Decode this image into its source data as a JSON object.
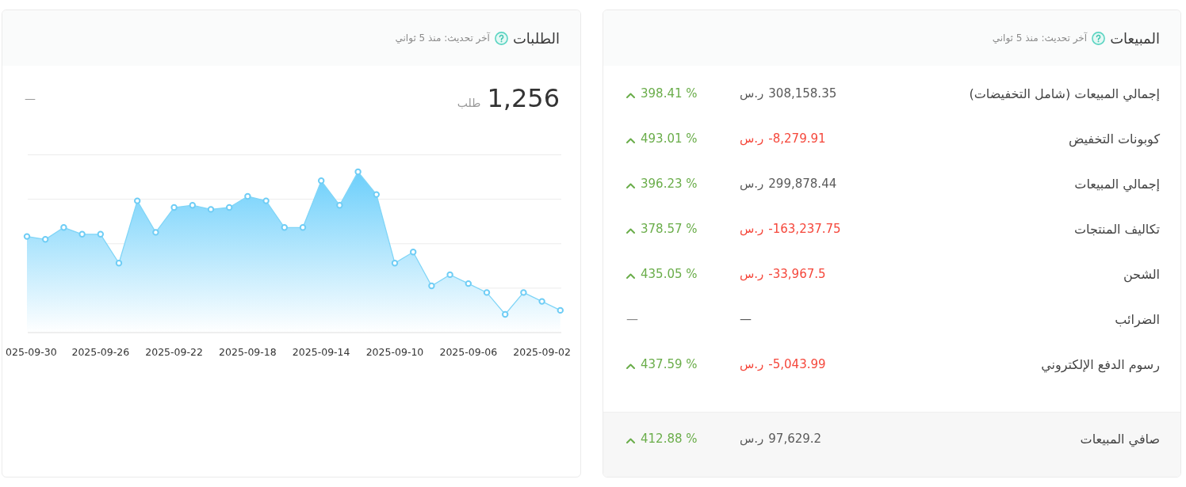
{
  "sales_card": {
    "title": "المبيعات",
    "last_update": "آخر تحديث: منذ 5 ثواني",
    "rows": [
      {
        "label": "إجمالي المبيعات (شامل التخفيضات)",
        "amount": "308,158.35",
        "currency": "ر.س",
        "negative": false,
        "change": "398.41 %",
        "rising": true
      },
      {
        "label": "كوبونات التخفيض",
        "amount": "-8,279.91",
        "currency": "ر.س",
        "negative": true,
        "change": "493.01 %",
        "rising": true
      },
      {
        "label": "إجمالي المبيعات",
        "amount": "299,878.44",
        "currency": "ر.س",
        "negative": false,
        "change": "396.23 %",
        "rising": true
      },
      {
        "label": "تكاليف المنتجات",
        "amount": "-163,237.75",
        "currency": "ر.س",
        "negative": true,
        "change": "378.57 %",
        "rising": true
      },
      {
        "label": "الشحن",
        "amount": "-33,967.5",
        "currency": "ر.س",
        "negative": true,
        "change": "435.05 %",
        "rising": true
      },
      {
        "label": "الضرائب",
        "amount": "—",
        "negative": false,
        "change": "—",
        "rising": false
      },
      {
        "label": "رسوم الدفع الإلكتروني",
        "amount": "-5,043.99",
        "currency": "ر.س",
        "negative": true,
        "change": "437.59 %",
        "rising": true
      }
    ],
    "total": {
      "label": "صافي المبيعات",
      "amount": "97,629.2",
      "currency": "ر.س",
      "negative": false,
      "change": "412.88 %",
      "rising": true
    }
  },
  "orders_card": {
    "title": "الطلبات",
    "last_update": "آخر تحديث: منذ 5 ثواني",
    "count": "1,256",
    "unit": "طلب",
    "comparison": "—",
    "chart": {
      "x_labels": [
        "2025-09-02",
        "2025-09-06",
        "2025-09-10",
        "2025-09-14",
        "2025-09-18",
        "2025-09-22",
        "2025-09-26",
        "025-09-30"
      ]
    }
  }
}
